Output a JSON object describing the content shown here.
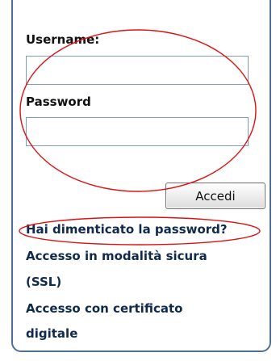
{
  "form": {
    "username_label": "Username:",
    "username_value": "",
    "password_label": "Password",
    "password_value": "",
    "submit_label": "Accedi"
  },
  "links": {
    "forgot_password": "Hai dimenticato la password?",
    "secure_access_line1": "Accesso in modalità sicura",
    "secure_access_line2": "(SSL)",
    "certificate_access_line1": "Accesso con certificato",
    "certificate_access_line2": "digitale"
  },
  "colors": {
    "panel_border": "#4d6f98",
    "input_border": "#7f9db9",
    "annotation_red": "#e01010",
    "link_text": "#0f2a4a"
  }
}
